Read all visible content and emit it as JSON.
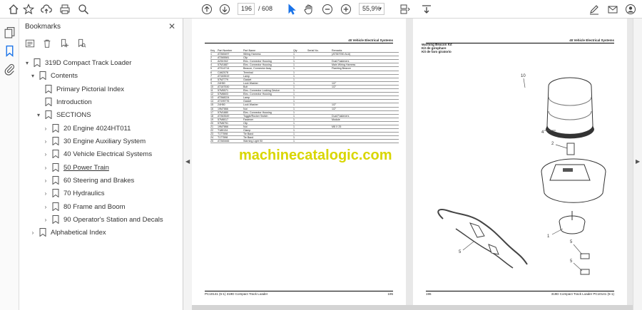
{
  "toolbar": {
    "page_current": "196",
    "page_total": "/ 608",
    "zoom": "55,9%"
  },
  "bookmarks": {
    "title": "Bookmarks",
    "close": "✕",
    "items": [
      {
        "label": "319D Compact Track Loader"
      },
      {
        "label": "Contents"
      },
      {
        "label": "Primary Pictorial Index"
      },
      {
        "label": "Introduction"
      },
      {
        "label": "SECTIONS"
      },
      {
        "label": "20 Engine 4024HT011"
      },
      {
        "label": "30 Engine Auxiliary System"
      },
      {
        "label": "40 Vehicle Electrical Systems"
      },
      {
        "label": "50 Power Train"
      },
      {
        "label": "60 Steering and Brakes"
      },
      {
        "label": "70 Hydraulics"
      },
      {
        "label": "80 Frame and Boom"
      },
      {
        "label": "90 Operator's Station and Decals"
      },
      {
        "label": "Alphabetical Index"
      }
    ]
  },
  "document": {
    "header_left": "40 Vehicle Electrical Systems",
    "header_right": "40 Vehicle Electrical Systems",
    "right_title": "Warning Beacon Kit",
    "right_sub1": "Kit de girophare",
    "right_sub2": "Kit de faro giratorio",
    "footer_left": "PC10141 (5-1)    319D Compact Track Loader",
    "footer_left_page": "195",
    "footer_right": "319D Compact Track Loader PC10141 (5-1)",
    "footer_right_page": "196",
    "watermark": "machinecatalogic.com",
    "table_headers": [
      "Key",
      "Part Number",
      "Part Name",
      "Qty",
      "Serial No.",
      "Remarks"
    ],
    "table_rows": [
      [
        "1",
        "AT365497",
        "Wiring Harness",
        "1",
        "",
        "(AT367930 ALA)"
      ],
      [
        "2",
        "AT365581",
        "Clip",
        "1",
        "",
        ""
      ],
      [
        "3",
        "AZ61942",
        "Elec. Connector Housing",
        "1",
        "",
        "Dust Fasteners"
      ],
      [
        "4",
        "57M1887",
        "Elec. Connector Housing",
        "1",
        "",
        "Main Wiring Harness"
      ],
      [
        "5",
        "AT314714",
        "Beacon, Connector Assy",
        "1",
        "",
        "Flashing Beacon"
      ],
      [
        "6",
        "CA62078",
        "Terminal",
        "1",
        "",
        ""
      ],
      [
        "7",
        "AT183519",
        "Lamp",
        "1",
        "",
        ""
      ],
      [
        "8",
        "57M7779",
        "Gasket",
        "1",
        "",
        ""
      ],
      [
        "9",
        "24H50",
        "Lock Washer",
        "1",
        "",
        "1/2\""
      ],
      [
        "10",
        "AT187530",
        "Bolt",
        "1",
        "",
        "1/2\""
      ],
      [
        "11",
        "57M5571",
        "Elec. Connector Locking Device",
        "1",
        "",
        ""
      ],
      [
        "12",
        "57M8603",
        "Elec. Connector Housing",
        "1",
        "",
        ""
      ],
      [
        "13",
        "AT368224",
        "Lamp",
        "1",
        "",
        ""
      ],
      [
        "14",
        "AT195776",
        "Gasket",
        "1",
        "",
        ""
      ],
      [
        "15",
        "24H50",
        "Lock Washer",
        "1",
        "",
        "1/2\""
      ],
      [
        "16",
        "19M7866",
        "Nut",
        "1",
        "",
        "1/2\""
      ],
      [
        "17",
        "57M1880",
        "Elec. Connector Housing",
        "1",
        "",
        ""
      ],
      [
        "18",
        "AT363549",
        "Toggle/Rocker Switch",
        "1",
        "",
        "Dual Fasteners"
      ],
      [
        "19",
        "57M8017",
        "Fastener",
        "1",
        "",
        "Module"
      ],
      [
        "20",
        "57M8751",
        "Clip",
        "1",
        "",
        ""
      ],
      [
        "21",
        "19M7866",
        "Nut",
        "1",
        "",
        "M8 X 25"
      ],
      [
        "22",
        "T185134",
        "Clamp",
        "1",
        "",
        ""
      ],
      [
        "23",
        "T177598",
        "Tie Band",
        "1",
        "",
        ""
      ],
      [
        "24",
        "T177598",
        "Tie Band",
        "1",
        "",
        ""
      ],
      [
        "25",
        "AT365466",
        "Warning Light Kit",
        "1",
        "",
        ""
      ]
    ]
  },
  "colors": {
    "accent": "#1a73e8",
    "watermark": "#d9d600"
  }
}
